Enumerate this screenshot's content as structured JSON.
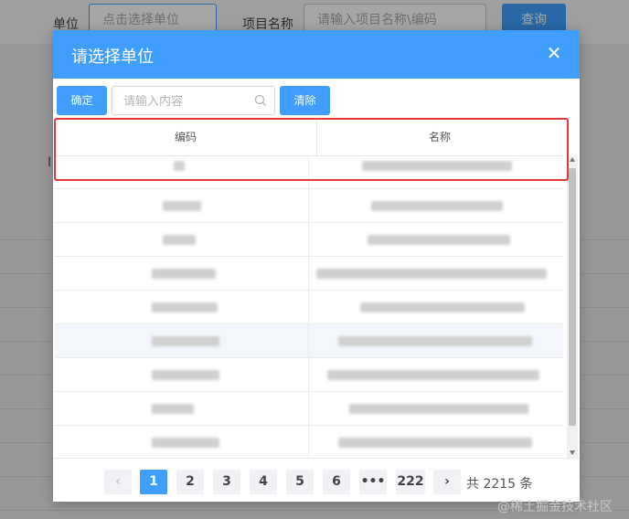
{
  "background": {
    "unit_label": "单位",
    "unit_placeholder": "点击选择单位",
    "project_label": "项目名称",
    "project_placeholder": "请输入项目名称\\编码",
    "query_button": "查询",
    "stub_text": "I"
  },
  "dialog": {
    "title": "请选择单位",
    "close_icon": "close-icon",
    "confirm_button": "确定",
    "search_placeholder": "请输入内容",
    "clear_button": "清除",
    "columns": [
      "编码",
      "名称"
    ]
  },
  "pagination": {
    "prev_icon": "chevron-left-icon",
    "next_icon": "chevron-right-icon",
    "pages": [
      "1",
      "2",
      "3",
      "4",
      "5",
      "6",
      "•••",
      "222"
    ],
    "current": "1",
    "total_text": "共 2215 条"
  },
  "watermark": "@稀土掘金技术社区",
  "colors": {
    "primary": "#409eff",
    "highlight": "#e53935"
  }
}
